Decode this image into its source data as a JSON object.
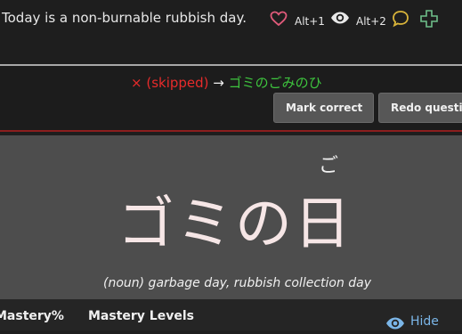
{
  "sentence": {
    "text": "Today is a non-burnable rubbish day.",
    "shortcut_1": "Alt+1",
    "shortcut_2": "Alt+2",
    "icons": [
      "heart-icon",
      "eye-icon",
      "speech-bubble-icon",
      "plus-icon"
    ]
  },
  "answer": {
    "wrong_mark": "× (skipped)",
    "arrow": "→",
    "correct_answer": "ゴミのごみのひ"
  },
  "buttons": {
    "mark_correct": "Mark correct",
    "redo_question": "Redo question"
  },
  "card": {
    "furigana": "ご",
    "word": "ゴミの日",
    "meaning": "(noun) garbage day, rubbish collection day"
  },
  "tabs": {
    "mastery_percent": "Mastery%",
    "mastery_levels": "Mastery Levels"
  },
  "hide_label": "Hide",
  "colors": {
    "wrong": "#e82b2b",
    "correct": "#3ec43e",
    "heart": "#e05a7a",
    "bubble": "#d9b43a",
    "plus": "#6fbf8a",
    "link": "#7bb6e8"
  }
}
